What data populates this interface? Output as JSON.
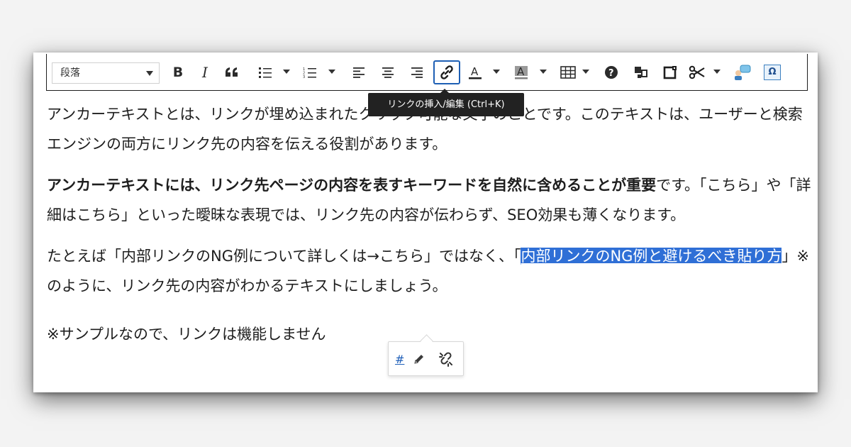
{
  "toolbar": {
    "format_select": "段落",
    "buttons": [
      {
        "name": "bold-icon",
        "glyph": "B"
      },
      {
        "name": "italic-icon",
        "glyph": "I"
      },
      {
        "name": "blockquote-icon",
        "glyph": "66"
      },
      {
        "name": "bullet-list-icon"
      },
      {
        "name": "numbered-list-icon"
      },
      {
        "name": "align-left-icon"
      },
      {
        "name": "align-center-icon"
      },
      {
        "name": "align-right-icon"
      },
      {
        "name": "insert-link-icon"
      },
      {
        "name": "text-color-icon"
      },
      {
        "name": "background-color-icon"
      },
      {
        "name": "table-icon"
      },
      {
        "name": "help-icon"
      },
      {
        "name": "shortcode-icon"
      },
      {
        "name": "box-icon"
      },
      {
        "name": "scissors-icon"
      },
      {
        "name": "balloon-icon"
      },
      {
        "name": "special-char-icon",
        "glyph": "Ω"
      }
    ],
    "active_button": "insert-link-icon",
    "text_color": "#1e1e1e",
    "bg_color": "#808080"
  },
  "tooltip": "リンクの挿入/編集 (Ctrl+K)",
  "content": {
    "p1": "アンカーテキストとは、リンクが埋め込まれたクリック可能な文字のことです。このテキストは、ユーザーと検索エンジンの両方にリンク先の内容を伝える役割があります。",
    "p2_bold": "アンカーテキストには、リンク先ページの内容を表すキーワードを自然に含めることが重要",
    "p2_rest": "です。「こちら」や「詳細はこちら」といった曖昧な表現では、リンク先の内容が伝わらず、SEO効果も薄くなります。",
    "p3_before": "たとえば「内部リンクのNG例について詳しくは→こちら」ではなく、「",
    "p3_link": "内部リンクのNG例と避けるべき貼り方",
    "p3_after": "」※のように、リンク先の内容がわかるテキストにしましょう。",
    "p4": "※サンプルなので、リンクは機能しません"
  },
  "link_popup": {
    "url": "#",
    "edit_icon": "pencil-icon",
    "unlink_icon": "unlink-icon"
  },
  "colors": {
    "selection": "#2f6fd6",
    "active_border": "#1e5fb4",
    "tooltip_bg": "#222222"
  }
}
